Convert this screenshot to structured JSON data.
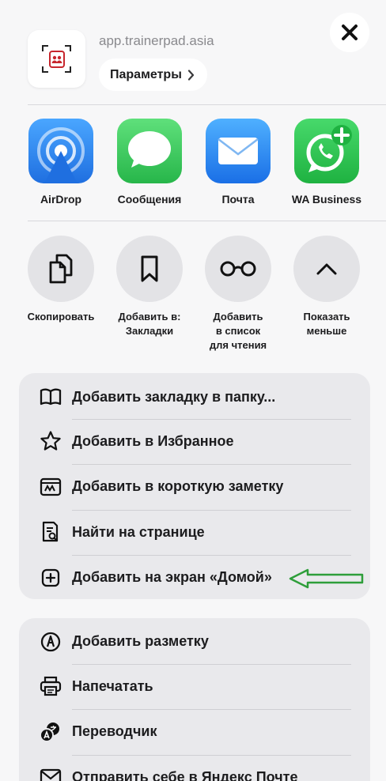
{
  "header": {
    "site_url": "app.trainerpad.asia",
    "options_label": "Параметры"
  },
  "apps": [
    {
      "name": "AirDrop",
      "icon": "airdrop-icon",
      "color": "#2f8ef5"
    },
    {
      "name": "Сообщения",
      "icon": "messages-icon",
      "color": "#36c759"
    },
    {
      "name": "Почта",
      "icon": "mail-icon",
      "color": "#2a86f2"
    },
    {
      "name": "WA Business",
      "icon": "whatsapp-business-icon",
      "color": "#27c24c"
    }
  ],
  "actions": [
    {
      "label": "Скопировать",
      "icon": "copy-icon"
    },
    {
      "label": "Добавить в:\nЗакладки",
      "icon": "bookmark-icon"
    },
    {
      "label": "Добавить\nв список\nдля чтения",
      "icon": "glasses-icon"
    },
    {
      "label": "Показать\nменьше",
      "icon": "chevron-up-icon"
    }
  ],
  "menu1": [
    {
      "label": "Добавить закладку в папку...",
      "icon": "book-icon"
    },
    {
      "label": "Добавить в Избранное",
      "icon": "star-icon"
    },
    {
      "label": "Добавить в короткую заметку",
      "icon": "quick-note-icon"
    },
    {
      "label": "Найти на странице",
      "icon": "find-on-page-icon"
    },
    {
      "label": "Добавить на экран «Домой»",
      "icon": "add-square-icon"
    }
  ],
  "menu2": [
    {
      "label": "Добавить разметку",
      "icon": "markup-icon"
    },
    {
      "label": "Напечатать",
      "icon": "print-icon"
    },
    {
      "label": "Переводчик",
      "icon": "translate-icon"
    },
    {
      "label": "Отправить себе в Яндекс Почте",
      "icon": "envelope-icon"
    }
  ],
  "annotation": {
    "arrow_color": "#2e9e3a"
  }
}
